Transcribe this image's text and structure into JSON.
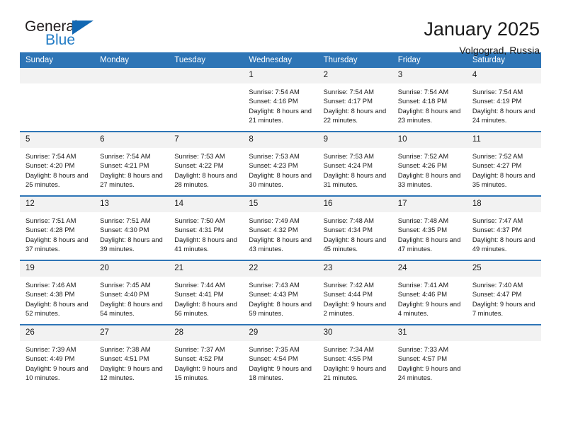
{
  "brand": {
    "name_part1": "General",
    "name_part2": "Blue",
    "triangle_color": "#1268b3",
    "blue_color": "#1f7ac4"
  },
  "header": {
    "title": "January 2025",
    "subtitle": "Volgograd, Russia"
  },
  "theme": {
    "header_blue": "#2e75b6",
    "daynum_gray": "#f2f2f2",
    "text": "#1a1a1a"
  },
  "weekdays": [
    "Sunday",
    "Monday",
    "Tuesday",
    "Wednesday",
    "Thursday",
    "Friday",
    "Saturday"
  ],
  "weeks": [
    [
      {
        "day": "",
        "empty": true
      },
      {
        "day": "",
        "empty": true
      },
      {
        "day": "",
        "empty": true
      },
      {
        "day": "1",
        "sunrise": "Sunrise: 7:54 AM",
        "sunset": "Sunset: 4:16 PM",
        "daylight": "Daylight: 8 hours and 21 minutes."
      },
      {
        "day": "2",
        "sunrise": "Sunrise: 7:54 AM",
        "sunset": "Sunset: 4:17 PM",
        "daylight": "Daylight: 8 hours and 22 minutes."
      },
      {
        "day": "3",
        "sunrise": "Sunrise: 7:54 AM",
        "sunset": "Sunset: 4:18 PM",
        "daylight": "Daylight: 8 hours and 23 minutes."
      },
      {
        "day": "4",
        "sunrise": "Sunrise: 7:54 AM",
        "sunset": "Sunset: 4:19 PM",
        "daylight": "Daylight: 8 hours and 24 minutes."
      }
    ],
    [
      {
        "day": "5",
        "sunrise": "Sunrise: 7:54 AM",
        "sunset": "Sunset: 4:20 PM",
        "daylight": "Daylight: 8 hours and 25 minutes."
      },
      {
        "day": "6",
        "sunrise": "Sunrise: 7:54 AM",
        "sunset": "Sunset: 4:21 PM",
        "daylight": "Daylight: 8 hours and 27 minutes."
      },
      {
        "day": "7",
        "sunrise": "Sunrise: 7:53 AM",
        "sunset": "Sunset: 4:22 PM",
        "daylight": "Daylight: 8 hours and 28 minutes."
      },
      {
        "day": "8",
        "sunrise": "Sunrise: 7:53 AM",
        "sunset": "Sunset: 4:23 PM",
        "daylight": "Daylight: 8 hours and 30 minutes."
      },
      {
        "day": "9",
        "sunrise": "Sunrise: 7:53 AM",
        "sunset": "Sunset: 4:24 PM",
        "daylight": "Daylight: 8 hours and 31 minutes."
      },
      {
        "day": "10",
        "sunrise": "Sunrise: 7:52 AM",
        "sunset": "Sunset: 4:26 PM",
        "daylight": "Daylight: 8 hours and 33 minutes."
      },
      {
        "day": "11",
        "sunrise": "Sunrise: 7:52 AM",
        "sunset": "Sunset: 4:27 PM",
        "daylight": "Daylight: 8 hours and 35 minutes."
      }
    ],
    [
      {
        "day": "12",
        "sunrise": "Sunrise: 7:51 AM",
        "sunset": "Sunset: 4:28 PM",
        "daylight": "Daylight: 8 hours and 37 minutes."
      },
      {
        "day": "13",
        "sunrise": "Sunrise: 7:51 AM",
        "sunset": "Sunset: 4:30 PM",
        "daylight": "Daylight: 8 hours and 39 minutes."
      },
      {
        "day": "14",
        "sunrise": "Sunrise: 7:50 AM",
        "sunset": "Sunset: 4:31 PM",
        "daylight": "Daylight: 8 hours and 41 minutes."
      },
      {
        "day": "15",
        "sunrise": "Sunrise: 7:49 AM",
        "sunset": "Sunset: 4:32 PM",
        "daylight": "Daylight: 8 hours and 43 minutes."
      },
      {
        "day": "16",
        "sunrise": "Sunrise: 7:48 AM",
        "sunset": "Sunset: 4:34 PM",
        "daylight": "Daylight: 8 hours and 45 minutes."
      },
      {
        "day": "17",
        "sunrise": "Sunrise: 7:48 AM",
        "sunset": "Sunset: 4:35 PM",
        "daylight": "Daylight: 8 hours and 47 minutes."
      },
      {
        "day": "18",
        "sunrise": "Sunrise: 7:47 AM",
        "sunset": "Sunset: 4:37 PM",
        "daylight": "Daylight: 8 hours and 49 minutes."
      }
    ],
    [
      {
        "day": "19",
        "sunrise": "Sunrise: 7:46 AM",
        "sunset": "Sunset: 4:38 PM",
        "daylight": "Daylight: 8 hours and 52 minutes."
      },
      {
        "day": "20",
        "sunrise": "Sunrise: 7:45 AM",
        "sunset": "Sunset: 4:40 PM",
        "daylight": "Daylight: 8 hours and 54 minutes."
      },
      {
        "day": "21",
        "sunrise": "Sunrise: 7:44 AM",
        "sunset": "Sunset: 4:41 PM",
        "daylight": "Daylight: 8 hours and 56 minutes."
      },
      {
        "day": "22",
        "sunrise": "Sunrise: 7:43 AM",
        "sunset": "Sunset: 4:43 PM",
        "daylight": "Daylight: 8 hours and 59 minutes."
      },
      {
        "day": "23",
        "sunrise": "Sunrise: 7:42 AM",
        "sunset": "Sunset: 4:44 PM",
        "daylight": "Daylight: 9 hours and 2 minutes."
      },
      {
        "day": "24",
        "sunrise": "Sunrise: 7:41 AM",
        "sunset": "Sunset: 4:46 PM",
        "daylight": "Daylight: 9 hours and 4 minutes."
      },
      {
        "day": "25",
        "sunrise": "Sunrise: 7:40 AM",
        "sunset": "Sunset: 4:47 PM",
        "daylight": "Daylight: 9 hours and 7 minutes."
      }
    ],
    [
      {
        "day": "26",
        "sunrise": "Sunrise: 7:39 AM",
        "sunset": "Sunset: 4:49 PM",
        "daylight": "Daylight: 9 hours and 10 minutes."
      },
      {
        "day": "27",
        "sunrise": "Sunrise: 7:38 AM",
        "sunset": "Sunset: 4:51 PM",
        "daylight": "Daylight: 9 hours and 12 minutes."
      },
      {
        "day": "28",
        "sunrise": "Sunrise: 7:37 AM",
        "sunset": "Sunset: 4:52 PM",
        "daylight": "Daylight: 9 hours and 15 minutes."
      },
      {
        "day": "29",
        "sunrise": "Sunrise: 7:35 AM",
        "sunset": "Sunset: 4:54 PM",
        "daylight": "Daylight: 9 hours and 18 minutes."
      },
      {
        "day": "30",
        "sunrise": "Sunrise: 7:34 AM",
        "sunset": "Sunset: 4:55 PM",
        "daylight": "Daylight: 9 hours and 21 minutes."
      },
      {
        "day": "31",
        "sunrise": "Sunrise: 7:33 AM",
        "sunset": "Sunset: 4:57 PM",
        "daylight": "Daylight: 9 hours and 24 minutes."
      },
      {
        "day": "",
        "empty": true
      }
    ]
  ]
}
